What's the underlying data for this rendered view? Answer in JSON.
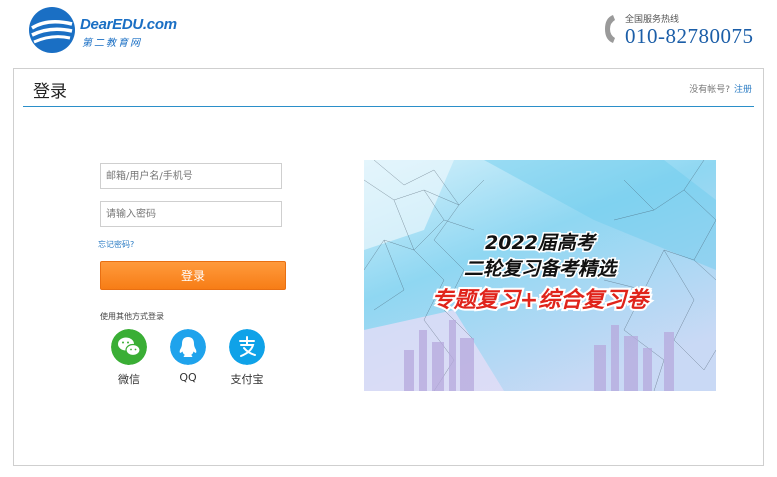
{
  "header": {
    "logo_en": "DearEDU.com",
    "logo_cn": "第二教育网",
    "hotline_label": "全国服务热线",
    "hotline_number": "010-82780075"
  },
  "panel": {
    "title": "登录",
    "no_account_text": "没有帐号?",
    "register_link": "注册"
  },
  "form": {
    "username_placeholder": "邮箱/用户名/手机号",
    "password_placeholder": "请输入密码",
    "forgot_link": "忘记密码?",
    "login_button": "登录",
    "other_login_label": "使用其他方式登录"
  },
  "social": [
    {
      "label": "微信",
      "icon": "wechat-icon",
      "color": "#3aae35"
    },
    {
      "label": "QQ",
      "icon": "qq-icon",
      "color": "#1fa3ec"
    },
    {
      "label": "支付宝",
      "icon": "alipay-icon",
      "color": "#0fa2e8"
    }
  ],
  "banner": {
    "line1": "2022届高考",
    "line2": "二轮复习备考精选",
    "line3": "专题复习+综合复习卷"
  },
  "colors": {
    "brand_blue": "#1a6fc4",
    "accent_orange": "#f77d16",
    "divider_blue": "#2b8fc9",
    "banner_red": "#e0241b"
  }
}
